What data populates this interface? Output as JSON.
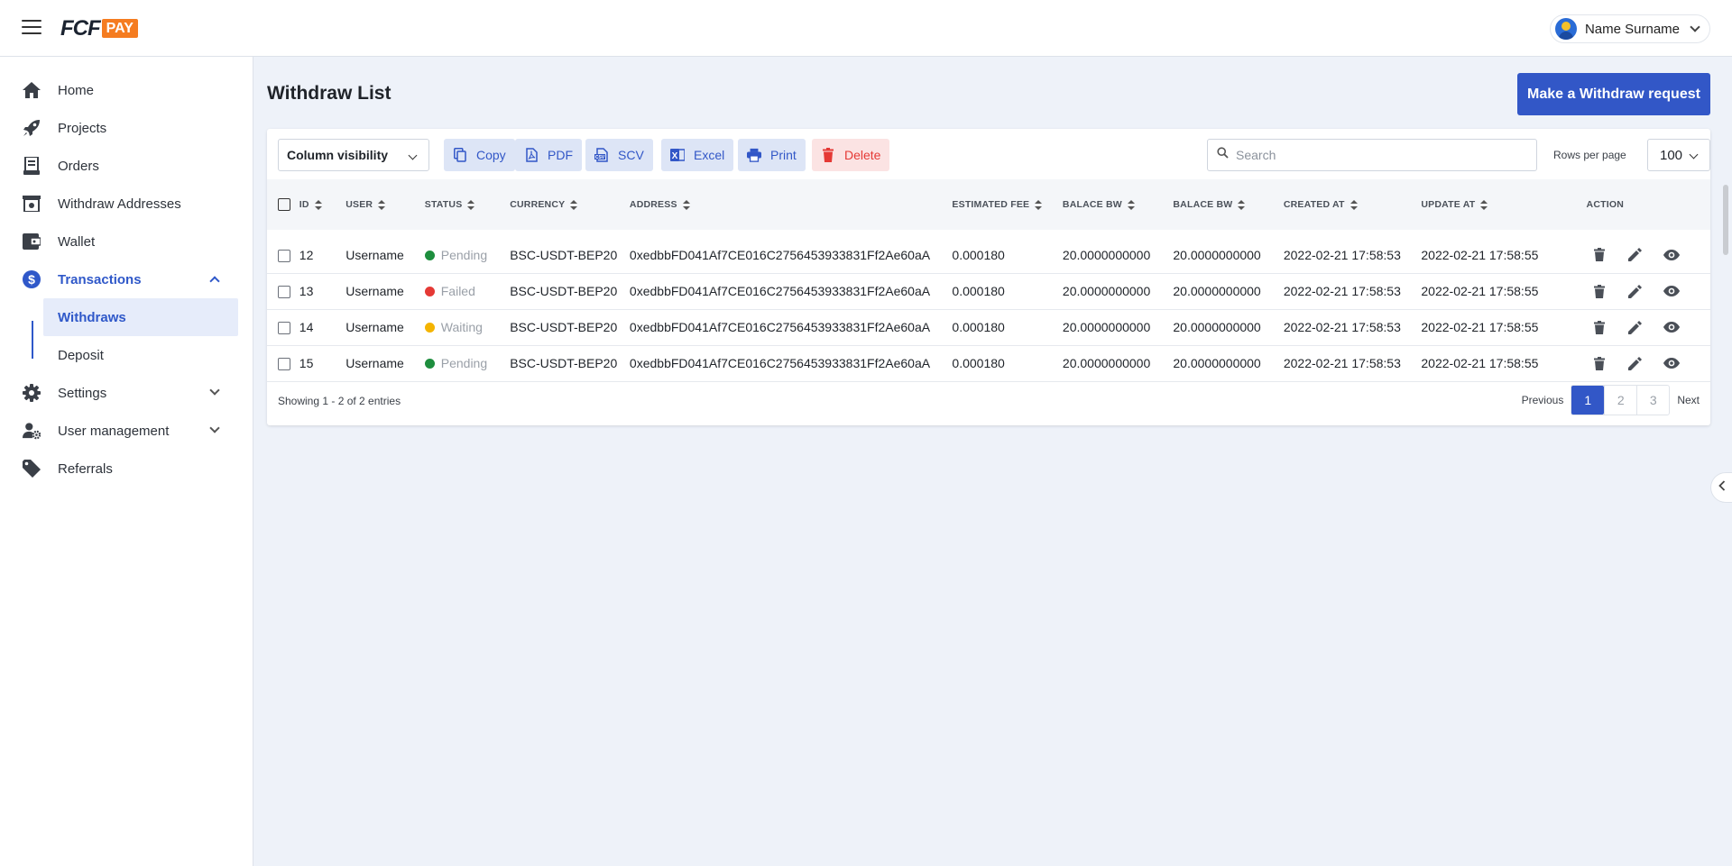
{
  "header": {
    "logo_main": "FCF",
    "logo_badge": "PAY",
    "user_name": "Name Surname"
  },
  "sidebar": {
    "items": [
      {
        "label": "Home",
        "icon": "home-icon"
      },
      {
        "label": "Projects",
        "icon": "rocket-icon"
      },
      {
        "label": "Orders",
        "icon": "receipt-icon"
      },
      {
        "label": "Withdraw Addresses",
        "icon": "wallet-address-icon"
      },
      {
        "label": "Wallet",
        "icon": "wallet-icon"
      },
      {
        "label": "Transactions",
        "icon": "dollar-icon"
      },
      {
        "label": "Settings",
        "icon": "gear-icon"
      },
      {
        "label": "User management",
        "icon": "user-gear-icon"
      },
      {
        "label": "Referrals",
        "icon": "tag-icon"
      }
    ],
    "sub_items": [
      {
        "label": "Withdraws"
      },
      {
        "label": "Deposit"
      }
    ]
  },
  "page": {
    "title": "Withdraw List",
    "primary_action": "Make a Withdraw request"
  },
  "toolbar": {
    "column_visibility": "Column visibility",
    "buttons": [
      "Copy",
      "PDF",
      "SCV",
      "Excel",
      "Print",
      "Delete"
    ],
    "search_placeholder": "Search",
    "rows_per_page_label": "Rows per page",
    "rows_per_page_value": "100"
  },
  "table": {
    "headers": [
      "ID",
      "USER",
      "STATUS",
      "CURRENCY",
      "ADDRESS",
      "ESTIMATED FEE",
      "BALACE BW",
      "BALACE BW",
      "CREATED AT",
      "UPDATE AT",
      "ACTION"
    ],
    "rows": [
      {
        "id": "12",
        "user": "Username",
        "status": "Pending",
        "status_color": "#1e8e3e",
        "currency": "BSC-USDT-BEP20",
        "address": "0xedbbFD041Af7CE016C2756453933831Ff2Ae60aA",
        "fee": "0.000180",
        "balance1": "20.0000000000",
        "balance2": "20.0000000000",
        "created": "2022-02-21 17:58:53",
        "updated": "2022-02-21 17:58:55"
      },
      {
        "id": "13",
        "user": "Username",
        "status": "Failed",
        "status_color": "#e53935",
        "currency": "BSC-USDT-BEP20",
        "address": "0xedbbFD041Af7CE016C2756453933831Ff2Ae60aA",
        "fee": "0.000180",
        "balance1": "20.0000000000",
        "balance2": "20.0000000000",
        "created": "2022-02-21 17:58:53",
        "updated": "2022-02-21 17:58:55"
      },
      {
        "id": "14",
        "user": "Username",
        "status": "Waiting",
        "status_color": "#f4b400",
        "currency": "BSC-USDT-BEP20",
        "address": "0xedbbFD041Af7CE016C2756453933831Ff2Ae60aA",
        "fee": "0.000180",
        "balance1": "20.0000000000",
        "balance2": "20.0000000000",
        "created": "2022-02-21 17:58:53",
        "updated": "2022-02-21 17:58:55"
      },
      {
        "id": "15",
        "user": "Username",
        "status": "Pending",
        "status_color": "#1e8e3e",
        "currency": "BSC-USDT-BEP20",
        "address": "0xedbbFD041Af7CE016C2756453933831Ff2Ae60aA",
        "fee": "0.000180",
        "balance1": "20.0000000000",
        "balance2": "20.0000000000",
        "created": "2022-02-21 17:58:53",
        "updated": "2022-02-21 17:58:55"
      }
    ]
  },
  "footer": {
    "showing": "Showing 1 - 2 of 2 entries",
    "previous": "Previous",
    "next": "Next",
    "pages": [
      "1",
      "2",
      "3"
    ],
    "current_page": "1"
  },
  "colors": {
    "accent": "#3257c7",
    "danger": "#e53935",
    "logo_orange": "#f57c20"
  }
}
